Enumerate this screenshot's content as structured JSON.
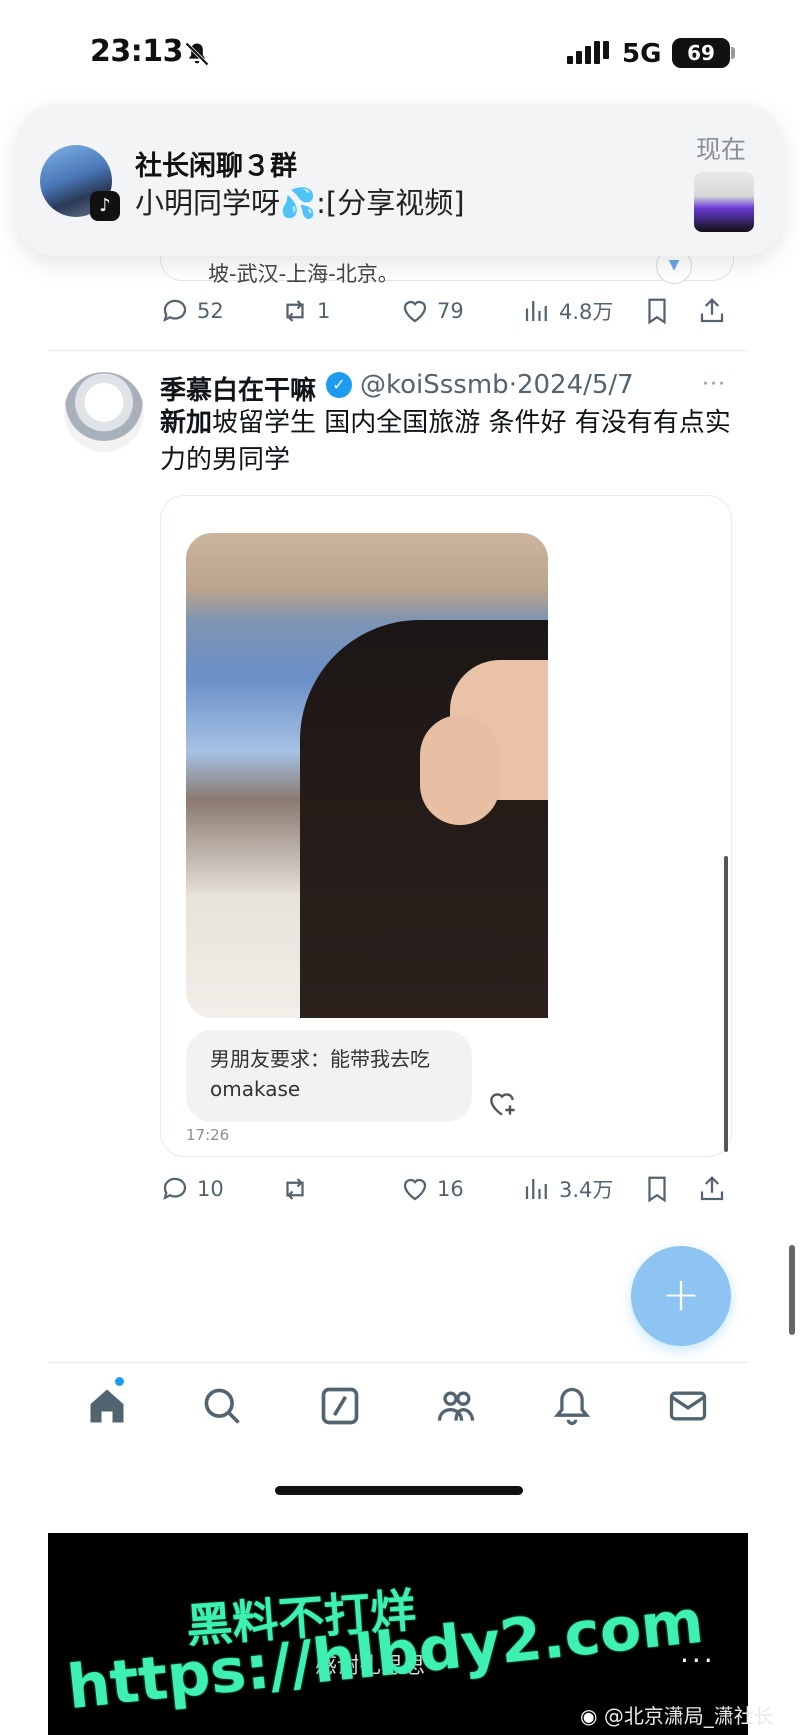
{
  "status_bar": {
    "time": "23:13",
    "network": "5G",
    "battery": "69"
  },
  "notification": {
    "title": "社长闲聊３群",
    "message": "小明同学呀💦:[分享视频]",
    "time": "现在",
    "app_badge": "♪"
  },
  "previous_post": {
    "text_fragment": "坡-武汉-上海-北京。",
    "actions": {
      "replies": "52",
      "retweets": "1",
      "likes": "79",
      "views": "4.8万"
    }
  },
  "tweet": {
    "name": "季慕白在干嘛",
    "handle_date": "@koiSssmb·2024/5/7",
    "text_bold": "新加",
    "text_rest": "坡留学生 国内全国旅游 条件好 有没有有点实力的男同学",
    "chat_message": "男朋友要求：能带我去吃omakase",
    "chat_time": "17:26",
    "actions": {
      "replies": "10",
      "retweets": "",
      "likes": "16",
      "views": "3.4万"
    }
  },
  "fab": {
    "label": "+"
  },
  "bottom_nav": {
    "items": [
      "home-icon",
      "search-icon",
      "grok-icon",
      "communities-icon",
      "notifications-icon",
      "messages-icon"
    ]
  },
  "bottom_strip": {
    "caption": "感谢扎思思",
    "more": "···"
  },
  "watermark": {
    "line1": "黑料不打烊",
    "line2": "https://hlbdy2.com"
  },
  "credit": "@北京潇局_潇社长",
  "colors": {
    "accent": "#1d9bf0",
    "fab": "#8ec4f2",
    "watermark": "#3ef0b2"
  }
}
